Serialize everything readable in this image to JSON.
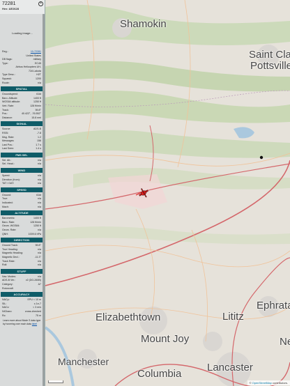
{
  "header": {
    "callsign": "72281",
    "hex_label": "Hex:",
    "hex": "AE2628",
    "close_glyph": "✕"
  },
  "photo": {
    "loading_text": "Loading image..."
  },
  "basic_rows": [
    {
      "label": "Reg.:",
      "value": "10-72281",
      "link": true
    },
    {
      "label": "",
      "value": "United States"
    },
    {
      "label": "DB flags:",
      "value": "military"
    },
    {
      "label": "Type:",
      "value": "EC45"
    },
    {
      "label": "",
      "value": "Airbus Helicopters UH-72A Lakota",
      "tall": true
    },
    {
      "label": "Type Desc.:",
      "value": "H2T"
    },
    {
      "label": "Squawk:",
      "value": "1200"
    },
    {
      "label": "Route:",
      "value": "n/a"
    }
  ],
  "sections": [
    {
      "title": "SPATIAL",
      "rows": [
        {
          "label": "Groundspeed:",
          "value": "61kt"
        },
        {
          "label": "Baro. Altitude:",
          "value": "1400 ft"
        },
        {
          "label": "WGS84 altitude:",
          "value": "1250 ft"
        },
        {
          "label": "Vert. Rate:",
          "value": "128 ft/min"
        },
        {
          "label": "Track:",
          "value": "59.8°"
        },
        {
          "label": "Pos.:",
          "value": "40.422°, -76.552°"
        },
        {
          "label": "Distance:",
          "value": "15.8 nmi"
        }
      ]
    },
    {
      "title": "SIGNAL",
      "rows": [
        {
          "label": "Source:",
          "value": "ADS-B"
        },
        {
          "label": "RSSI:",
          "value": "-7.8"
        },
        {
          "label": "Msg. Rate:",
          "value": "1.2"
        },
        {
          "label": "Messages:",
          "value": "156"
        },
        {
          "label": "Last Pos.:",
          "value": "1.7 s"
        },
        {
          "label": "Last Seen:",
          "value": "1.4 s"
        }
      ]
    },
    {
      "title": "FMS SEL",
      "rows": [
        {
          "label": "Sel. Alt.:",
          "value": "n/a"
        },
        {
          "label": "Sel. Head.:",
          "value": "n/a"
        }
      ]
    },
    {
      "title": "WIND",
      "rows": [
        {
          "label": "Speed:",
          "value": "n/a"
        },
        {
          "label": "Direction (from):",
          "value": "n/a"
        },
        {
          "label": "TAT / OAT:",
          "value": "n/a"
        }
      ]
    },
    {
      "title": "SPEED",
      "rows": [
        {
          "label": "Ground:",
          "value": "61kt"
        },
        {
          "label": "True:",
          "value": "n/a"
        },
        {
          "label": "Indicated:",
          "value": "n/a"
        },
        {
          "label": "Mach:",
          "value": "n/a"
        }
      ]
    },
    {
      "title": "ALTITUDE",
      "rows": [
        {
          "label": "Barometric:",
          "value": "1400 ft"
        },
        {
          "label": "Baro. Rate:",
          "value": "128 ft/min"
        },
        {
          "label": "Geom. WGS84:",
          "value": "1250 ft"
        },
        {
          "label": "Geom. Rate:",
          "value": "n/a"
        },
        {
          "label": "QNH:",
          "value": "1009.6 hPa"
        }
      ]
    },
    {
      "title": "DIRECTION",
      "rows": [
        {
          "label": "Ground Track:",
          "value": "59.8°"
        },
        {
          "label": "True Heading:",
          "value": "n/a"
        },
        {
          "label": "Magnetic Heading:",
          "value": "n/a"
        },
        {
          "label": "Magnetic Decl.:",
          "value": "-11.3°"
        },
        {
          "label": "Track Rate:",
          "value": "n/a"
        },
        {
          "label": "Roll:",
          "value": "n/a"
        }
      ]
    },
    {
      "title": "STUFF",
      "rows": [
        {
          "label": "Nav. Modes:",
          "value": "n/a"
        },
        {
          "label": "ADS-B Ver.:",
          "value": "v2 (DO-260B)"
        },
        {
          "label": "Category:",
          "value": "A7"
        },
        {
          "label": "Rotorcraft",
          "value": ""
        }
      ]
    },
    {
      "title": "ACCURACY",
      "rows": [
        {
          "label": "NACp:",
          "value": "EPU < 10 m"
        },
        {
          "label": "SIL:",
          "value": "≤ 1e-7"
        },
        {
          "label": "NACv:",
          "value": "< 3 m/s"
        },
        {
          "label": "NICbaro:",
          "value": "cross-checked"
        },
        {
          "label": "Rc:",
          "value": "75 m"
        }
      ]
    }
  ],
  "learn_more": {
    "text": "Learn more about Mode S data type by hovering over each data ",
    "link": "label"
  },
  "map": {
    "places": [
      {
        "name": "Shamokin"
      },
      {
        "name": "Saint Clair"
      },
      {
        "name": "Pottsville"
      },
      {
        "name": "Elizabethtown"
      },
      {
        "name": "Lititz"
      },
      {
        "name": "Ephrata"
      },
      {
        "name": "Mount Joy"
      },
      {
        "name": "Manchester"
      },
      {
        "name": "Lancaster"
      },
      {
        "name": "Columbia"
      },
      {
        "name": "Ne"
      }
    ],
    "attribution_prefix": "© ",
    "attribution_link": "OpenStreetMap",
    "attribution_suffix": " contributors.",
    "colors": {
      "land": "#e6e2da",
      "forest": "#c5d6b2",
      "water": "#aac8de",
      "road": "#d4676b",
      "minor_road": "#f0c39a",
      "aircraft": "#e02020"
    },
    "aircraft_icon": "helicopter-icon"
  }
}
